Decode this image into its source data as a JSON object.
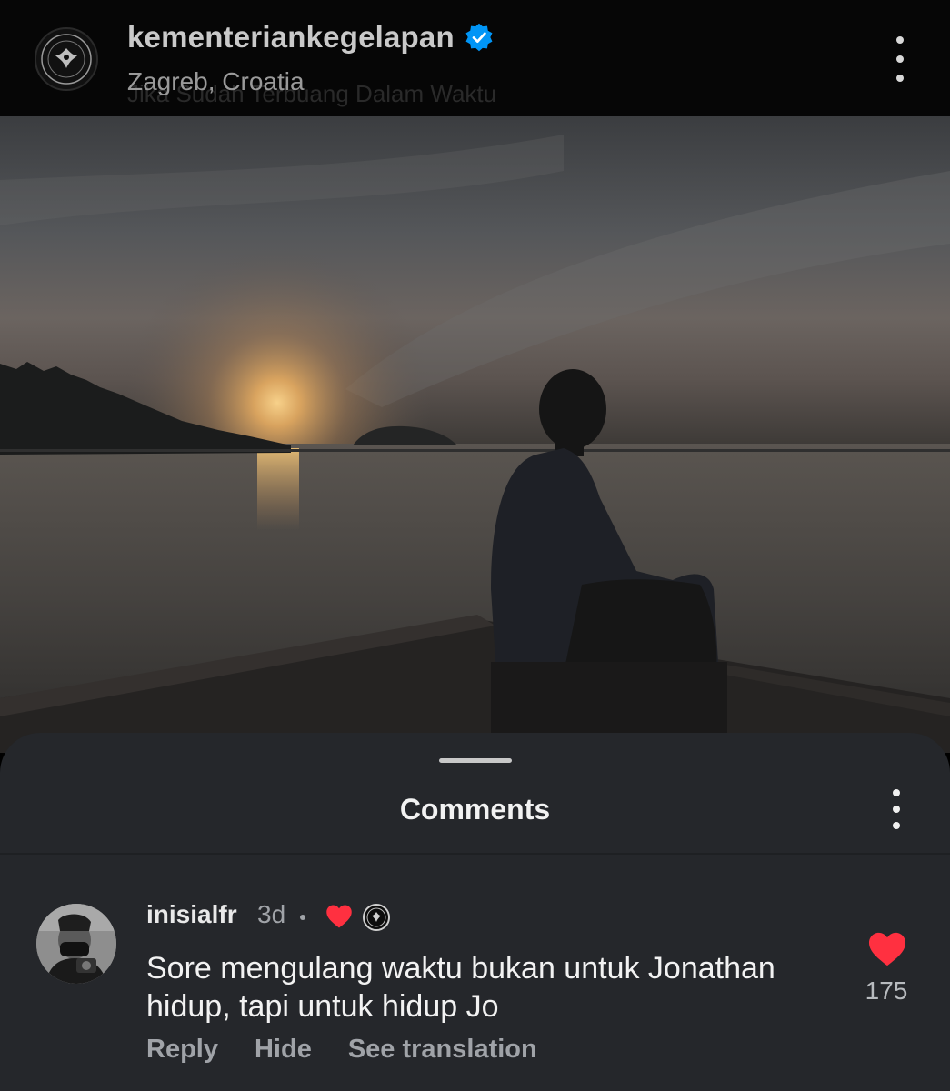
{
  "post": {
    "username": "kementeriankegelapan",
    "verified_icon": "verified-badge-icon",
    "location": "Zagreb, Croatia",
    "caption_preview": "Jika Sudah Terbuang Dalam Waktu",
    "more_icon": "more-vertical-icon"
  },
  "comments_sheet": {
    "title": "Comments",
    "more_icon": "more-vertical-icon",
    "comments": [
      {
        "username": "inisialfr",
        "time": "3d",
        "author_liked": true,
        "text": "Sore mengulang waktu bukan untuk Jonathan hidup, tapi untuk hidup Jo",
        "likes": "175",
        "actions": {
          "reply": "Reply",
          "hide": "Hide",
          "translate": "See translation"
        }
      }
    ]
  },
  "colors": {
    "accent_red": "#ff3040",
    "verified_blue": "#0095f6",
    "sheet_bg": "#25272b"
  }
}
